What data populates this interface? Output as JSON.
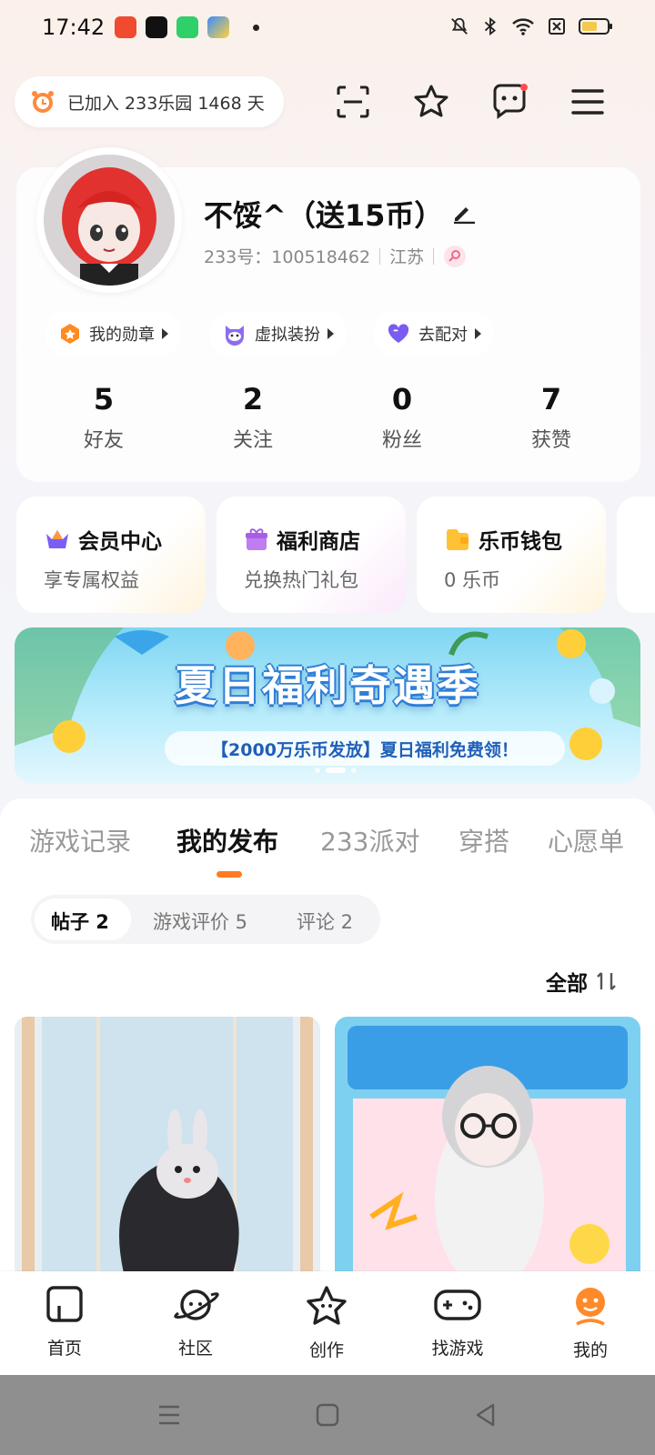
{
  "status_bar": {
    "time": "17:42",
    "app_icons": [
      "video-app-icon",
      "tiktok-icon",
      "iqiyi-icon",
      "play-app-icon"
    ],
    "icons": [
      "mute-icon",
      "bluetooth-icon",
      "wifi-icon",
      "battery-icon"
    ]
  },
  "header": {
    "join_text": "已加入 233乐园 1468 天",
    "icons": [
      "scan-icon",
      "star-icon",
      "message-icon",
      "menu-icon"
    ]
  },
  "profile": {
    "nickname": "不馁^（送15币）",
    "id_label": "233号：100518462",
    "location": "江苏",
    "chips": [
      {
        "label": "我的勋章",
        "icon": "medal-icon"
      },
      {
        "label": "虚拟装扮",
        "icon": "avatar-dress-icon"
      },
      {
        "label": "去配对",
        "icon": "heart-icon"
      }
    ],
    "stats": [
      {
        "value": "5",
        "label": "好友"
      },
      {
        "value": "2",
        "label": "关注"
      },
      {
        "value": "0",
        "label": "粉丝"
      },
      {
        "value": "7",
        "label": "获赞"
      }
    ]
  },
  "features": [
    {
      "title": "会员中心",
      "subtitle": "享专属权益",
      "icon": "crown-icon"
    },
    {
      "title": "福利商店",
      "subtitle": "兑换热门礼包",
      "icon": "gift-icon"
    },
    {
      "title": "乐币钱包",
      "subtitle": "0 乐币",
      "icon": "wallet-icon"
    }
  ],
  "banner": {
    "title": "夏日福利奇遇季",
    "subtitle": "【2000万乐币发放】夏日福利免费领！"
  },
  "tabs": [
    "游戏记录",
    "我的发布",
    "233派对",
    "穿搭",
    "心愿单"
  ],
  "active_tab": "我的发布",
  "subtabs": [
    "帖子 2",
    "游戏评价 5",
    "评论 2"
  ],
  "sort_label": "全部",
  "posts": [
    {
      "label": "post-1"
    },
    {
      "label": "post-2"
    }
  ],
  "bottom_nav": [
    {
      "label": "首页",
      "icon": "home-icon"
    },
    {
      "label": "社区",
      "icon": "planet-icon"
    },
    {
      "label": "创作",
      "icon": "create-star-icon"
    },
    {
      "label": "找游戏",
      "icon": "gamepad-icon"
    },
    {
      "label": "我的",
      "icon": "profile-icon"
    }
  ],
  "colors": {
    "accent": "#ff7a21",
    "text": "#111111",
    "muted": "#999999"
  }
}
